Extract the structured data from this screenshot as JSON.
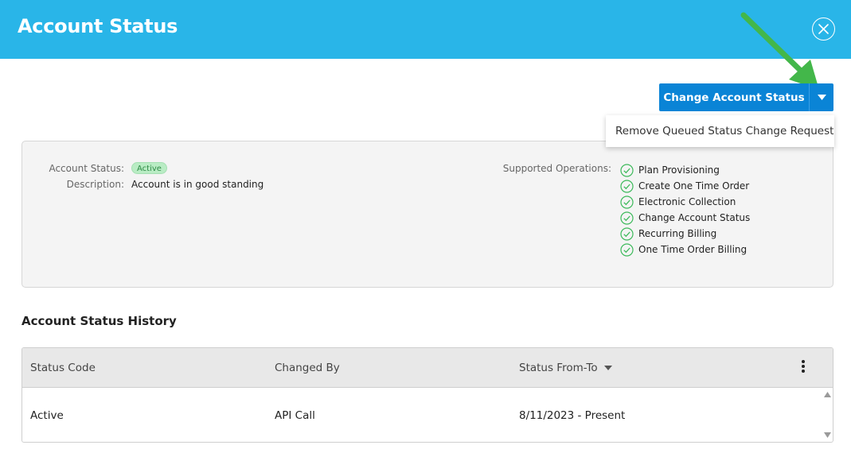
{
  "dialog": {
    "title": "Account Status"
  },
  "actions": {
    "change_status_label": "Change Account Status",
    "menu_items": [
      "Remove Queued Status Change Request"
    ]
  },
  "account": {
    "status_label": "Account Status:",
    "status_value": "Active",
    "description_label": "Description:",
    "description_value": "Account is in good standing",
    "supported_operations_label": "Supported Operations:",
    "supported_operations": [
      "Plan Provisioning",
      "Create One Time Order",
      "Electronic Collection",
      "Change Account Status",
      "Recurring Billing",
      "One Time Order Billing"
    ]
  },
  "history": {
    "title": "Account Status History",
    "columns": [
      "Status Code",
      "Changed By",
      "Status From-To"
    ],
    "rows": [
      {
        "status_code": "Active",
        "changed_by": "API Call",
        "status_from_to": "8/11/2023 - Present"
      }
    ]
  },
  "colors": {
    "header": "#29b5e8",
    "primary_button": "#0a84d6",
    "active_badge": "#b9ecc4",
    "check_icon": "#3cb95a",
    "annotation_arrow": "#43b74a"
  },
  "icons": {
    "close": "close-circle-icon",
    "dropdown": "caret-down-icon",
    "check": "check-circle-icon",
    "sort": "sort-desc-icon",
    "menu": "kebab-menu-icon",
    "arrow": "annotation-arrow-icon"
  }
}
